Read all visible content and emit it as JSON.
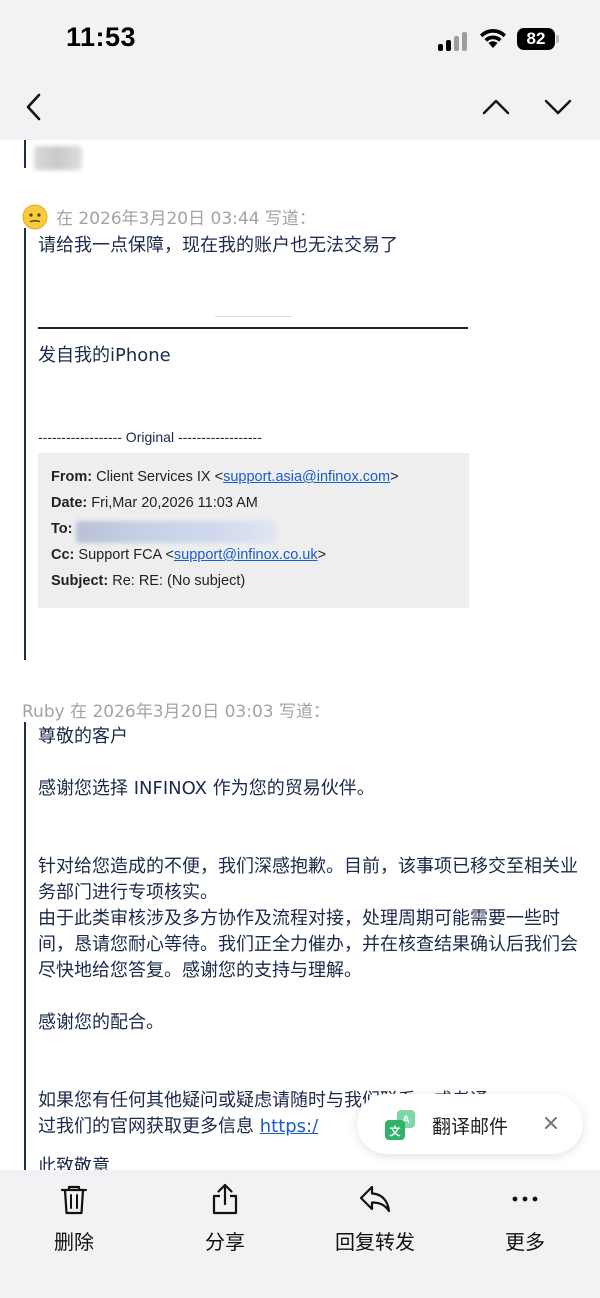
{
  "status_bar": {
    "time": "11:53",
    "battery": "82"
  },
  "quoted_message_1": {
    "attribution": "在 2026年3月20日 03:44 写道：",
    "body": "请给我一点保障，现在我的账户也无法交易了",
    "signature": "发自我的iPhone",
    "original_separator": "------------------ Original ------------------",
    "headers": {
      "from_label": "From:",
      "from_name": "Client Services IX <",
      "from_email": "support.asia@infinox.com",
      "from_close": ">",
      "date_label": "Date:",
      "date_value": "Fri,Mar 20,2026 11:03 AM",
      "to_label": "To:",
      "cc_label": "Cc:",
      "cc_name": "Support FCA <",
      "cc_email": "support@infinox.co.uk",
      "cc_close": ">",
      "subject_label": "Subject:",
      "subject_value": "Re: RE: (No subject)"
    }
  },
  "quoted_message_2": {
    "attribution": "Ruby 在 2026年3月20日 03:03 写道：",
    "greeting": "尊敬的客户",
    "thanks": "感谢您选择 INFINOX 作为您的贸易伙伴。",
    "para1": "针对给您造成的不便，我们深感抱歉。目前，该事项已移交至相关业务部门进行专项核实。",
    "para2": "由于此类审核涉及多方协作及流程对接，处理周期可能需要一些时间，恳请您耐心等待。我们正全力催办，并在核查结果确认后我们会尽快地给您答复。感谢您的支持与理解。",
    "para3": "感谢您的配合。",
    "para4_line1": "如果您有任何其他疑问或疑虑请随时与我们联系，或者通",
    "para4_line2": "过我们的官网获取更多信息 ",
    "para4_link": "https:/",
    "closing_partial": "此致敬意"
  },
  "translate_pill": {
    "label": "翻译邮件"
  },
  "toolbar": {
    "delete": "删除",
    "share": "分享",
    "reply_forward": "回复转发",
    "more": "更多"
  },
  "colors": {
    "accent": "#1a5dc9",
    "text": "#1a2a4a",
    "quote_bar": "#1d2b55",
    "bar_bg": "#f2f2f4"
  }
}
